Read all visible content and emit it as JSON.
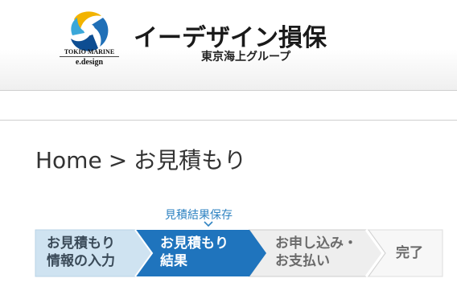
{
  "header": {
    "logo_line1": "TOKIO MARINE",
    "logo_line2": "e.design",
    "brand_name": "イーデザイン損保",
    "group_name": "東京海上グループ"
  },
  "breadcrumb": {
    "home": "Home",
    "separator": ">",
    "current": "お見積もり"
  },
  "save_link": "見積結果保存",
  "steps": [
    {
      "label": "お見積もり\n情報の入力",
      "state": "done"
    },
    {
      "label": "お見積もり\n結果",
      "state": "current"
    },
    {
      "label": "お申し込み・\nお支払い",
      "state": "upcoming"
    },
    {
      "label": "完了",
      "state": "upcoming"
    }
  ],
  "colors": {
    "done_bg": "#cfe3f1",
    "current_bg": "#1f74bd",
    "upcoming_bg": "#eeeeee",
    "link": "#2f83c2"
  }
}
